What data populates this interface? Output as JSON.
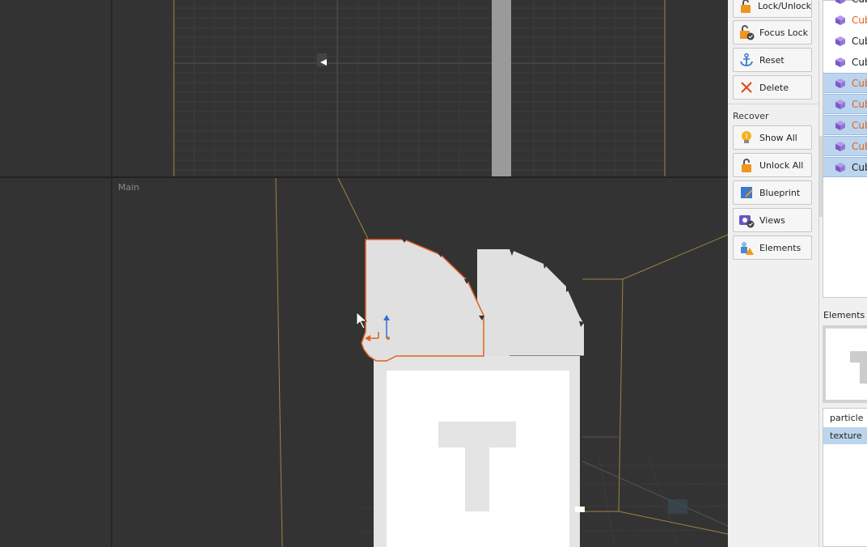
{
  "viewport": {
    "label": "Main",
    "colors": {
      "background": "#333333",
      "grid_line": "#3d3d3d",
      "bound_line": "#a08a40",
      "selection": "#e0621e",
      "model": "#e2e2e2"
    }
  },
  "tools": {
    "lock_unlock": "Lock/Unlock",
    "focus_lock": "Focus Lock",
    "reset": "Reset",
    "delete": "Delete",
    "recover_label": "Recover",
    "show_all": "Show All",
    "unlock_all": "Unlock All",
    "blueprint": "Blueprint",
    "views": "Views",
    "elements": "Elements"
  },
  "tree": {
    "items": [
      {
        "label": "Cub",
        "color": "#222222",
        "selected": false
      },
      {
        "label": "Cub",
        "color": "#e0621e",
        "selected": false
      },
      {
        "label": "Cub",
        "color": "#222222",
        "selected": false
      },
      {
        "label": "Cub",
        "color": "#222222",
        "selected": false
      },
      {
        "label": "Cub",
        "color": "#e0621e",
        "selected": true
      },
      {
        "label": "Cub",
        "color": "#e0621e",
        "selected": true
      },
      {
        "label": "Cub",
        "color": "#e0621e",
        "selected": true
      },
      {
        "label": "Cub",
        "color": "#e0621e",
        "selected": true
      },
      {
        "label": "Cub",
        "color": "#222222",
        "selected": true
      }
    ]
  },
  "elements_panel": {
    "header": "Elements M",
    "list": [
      {
        "label": "particle",
        "selected": false
      },
      {
        "label": "texture",
        "selected": true
      }
    ]
  }
}
